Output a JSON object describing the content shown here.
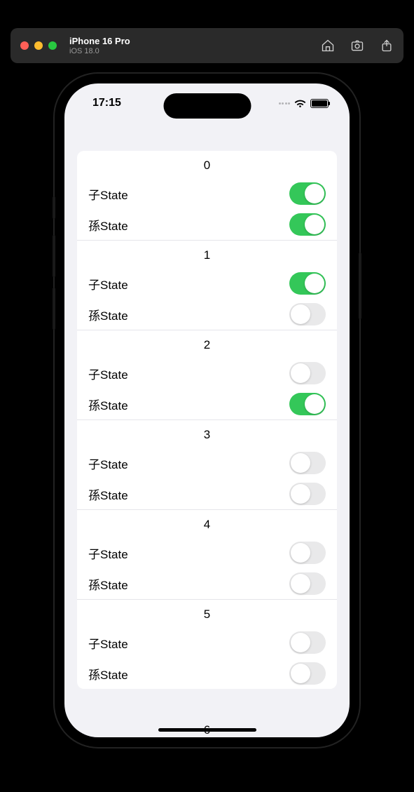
{
  "simulator": {
    "device": "iPhone 16 Pro",
    "os": "iOS 18.0"
  },
  "status": {
    "time": "17:15"
  },
  "labels": {
    "child": "子State",
    "grandchild": "孫State"
  },
  "sections": [
    {
      "index": "0",
      "child_on": true,
      "grandchild_on": true
    },
    {
      "index": "1",
      "child_on": true,
      "grandchild_on": false
    },
    {
      "index": "2",
      "child_on": false,
      "grandchild_on": true
    },
    {
      "index": "3",
      "child_on": false,
      "grandchild_on": false
    },
    {
      "index": "4",
      "child_on": false,
      "grandchild_on": false
    },
    {
      "index": "5",
      "child_on": false,
      "grandchild_on": false
    }
  ],
  "peek_index": "6"
}
